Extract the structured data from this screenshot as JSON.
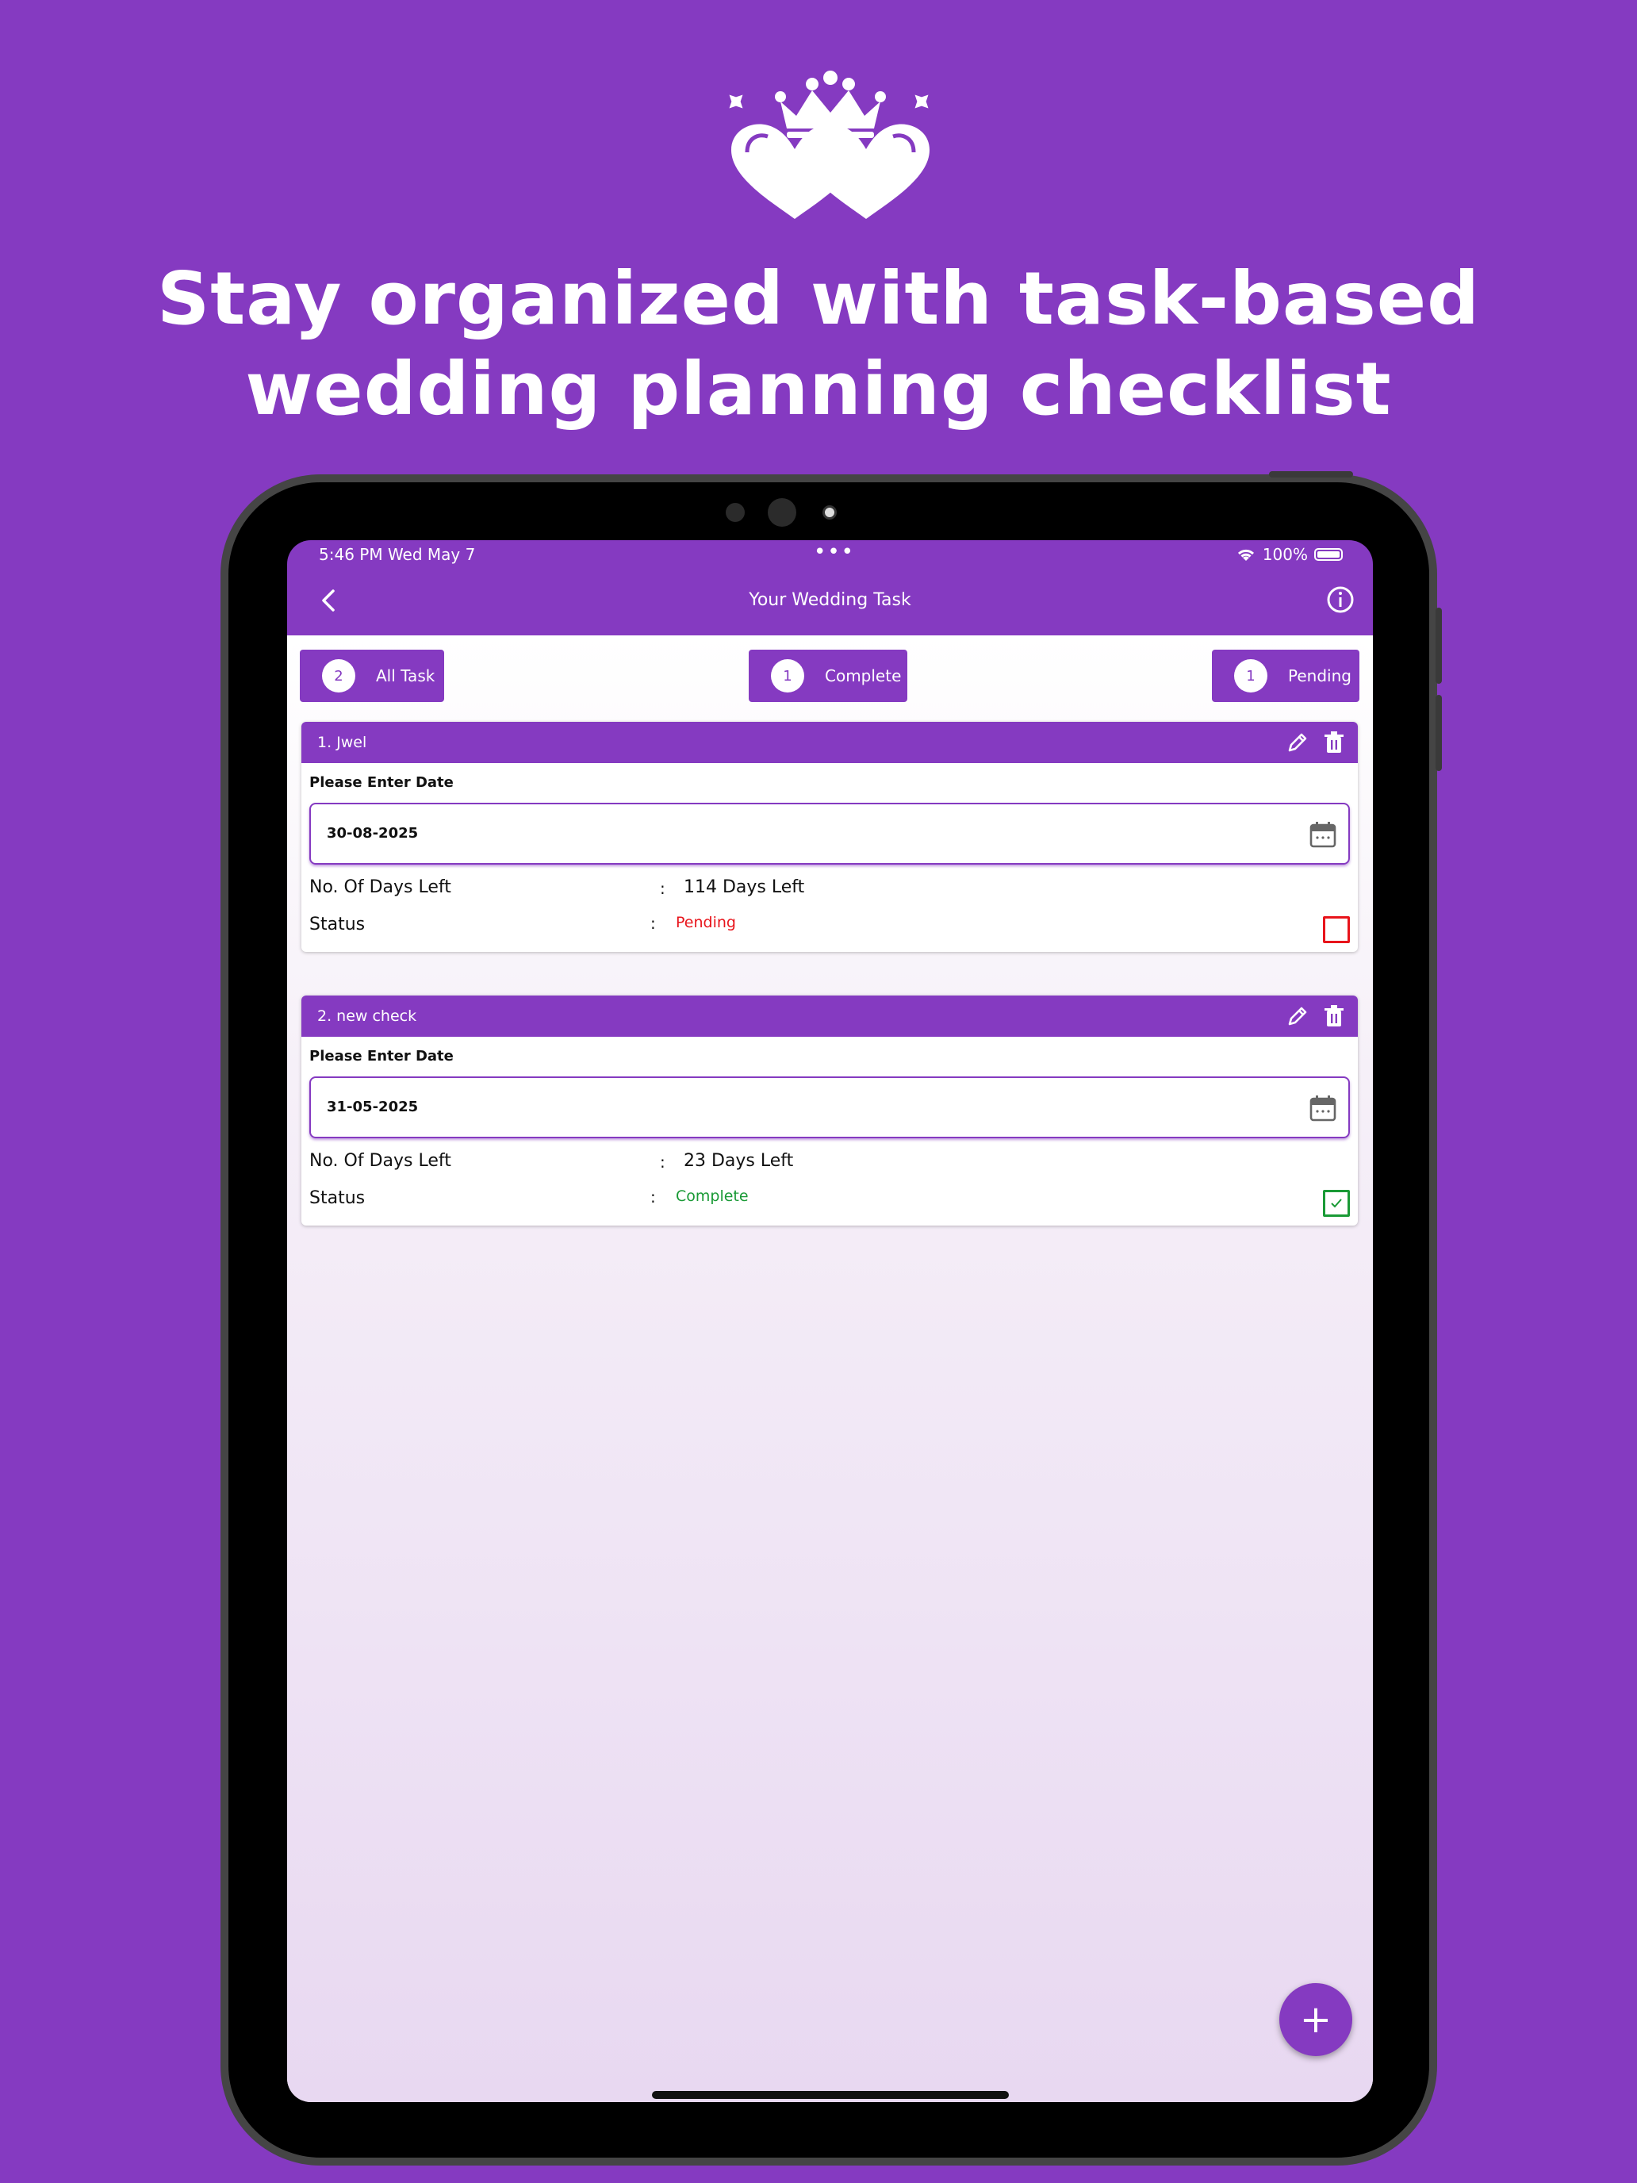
{
  "headline": {
    "line1": "Stay organized with task-based",
    "line2": "wedding planning checklist"
  },
  "logo": {
    "icon": "crown-hearts-icon"
  },
  "status_bar": {
    "time_date": "5:46 PM   Wed May 7",
    "battery": "100%"
  },
  "app_bar": {
    "title": "Your Wedding Task"
  },
  "tabs": [
    {
      "count": "2",
      "label": "All Task"
    },
    {
      "count": "1",
      "label": "Complete"
    },
    {
      "count": "1",
      "label": "Pending"
    }
  ],
  "tasks": [
    {
      "title": "1.  Jwel",
      "date_label": "Please Enter Date",
      "date_value": "30-08-2025",
      "days_label": "No. Of Days Left",
      "days_value": "114 Days Left",
      "status_label": "Status",
      "status_value": "Pending",
      "status_color": "#e8141b",
      "checked": false
    },
    {
      "title": "2.  new check",
      "date_label": "Please Enter Date",
      "date_value": "31-05-2025",
      "days_label": "No. Of Days Left",
      "days_value": "23 Days Left",
      "status_label": "Status",
      "status_value": "Complete",
      "status_color": "#1a9a36",
      "checked": true
    }
  ],
  "separator": ":",
  "fab": {
    "icon": "plus-icon",
    "symbol": "+"
  },
  "colors": {
    "brand": "#853ac1",
    "pending": "#e8141b",
    "complete": "#1a9a36"
  }
}
